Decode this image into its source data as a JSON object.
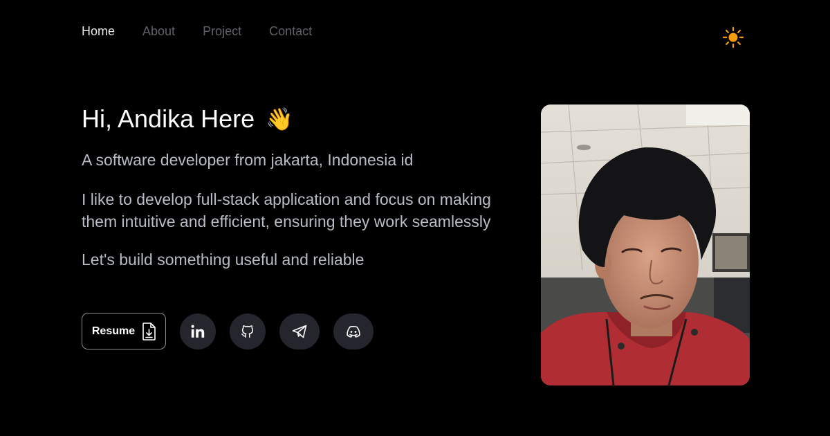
{
  "nav": {
    "links": [
      {
        "label": "Home",
        "active": true
      },
      {
        "label": "About",
        "active": false
      },
      {
        "label": "Project",
        "active": false
      },
      {
        "label": "Contact",
        "active": false
      }
    ]
  },
  "theme_toggle": {
    "icon": "sun-icon",
    "color": "#f59e0b"
  },
  "hero": {
    "greeting": "Hi, Andika Here",
    "wave_emoji": "👋",
    "subtitle": "A software developer from jakarta, Indonesia id",
    "bio": "I like to develop full-stack application and focus on making them intuitive and efficient, ensuring they work seamlessly",
    "tagline": "Let's build something useful and reliable"
  },
  "actions": {
    "resume_label": "Resume",
    "resume_icon": "file-download-icon",
    "social": [
      {
        "name": "linkedin",
        "icon": "linkedin-icon"
      },
      {
        "name": "github",
        "icon": "github-icon"
      },
      {
        "name": "telegram",
        "icon": "telegram-icon"
      },
      {
        "name": "discord",
        "icon": "discord-icon"
      }
    ]
  },
  "colors": {
    "background": "#000000",
    "text_primary": "#ffffff",
    "text_secondary": "#b8bcc4",
    "nav_inactive": "#5f6168",
    "social_bg": "#25262d",
    "accent_sun": "#f59e0b"
  }
}
